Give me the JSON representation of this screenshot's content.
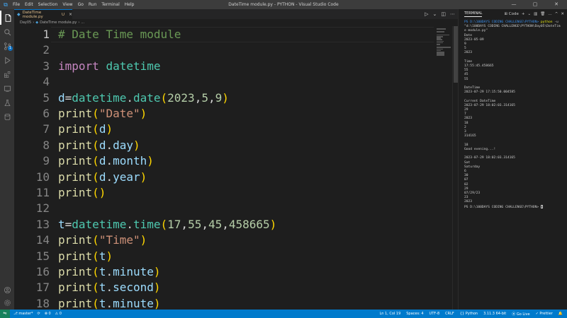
{
  "titlebar": {
    "menu": [
      "File",
      "Edit",
      "Selection",
      "View",
      "Go",
      "Run",
      "Terminal",
      "Help"
    ],
    "title": "DateTime module.py - PYTHON - Visual Studio Code",
    "min": "—",
    "max": "▢",
    "close": "✕"
  },
  "tab": {
    "label": "DateTime module.py",
    "modified": "U",
    "close": "×"
  },
  "breadcrumb": {
    "folder": "Day05",
    "sep": "›",
    "file": "DateTime module.py",
    "sep2": "›",
    "more": "..."
  },
  "editor": {
    "current_line": 1,
    "lines": [
      {
        "n": "1",
        "tokens": [
          [
            "comment",
            "# Date Time module"
          ]
        ]
      },
      {
        "n": "2",
        "tokens": []
      },
      {
        "n": "3",
        "tokens": [
          [
            "kw",
            "import"
          ],
          [
            "op",
            " "
          ],
          [
            "mod",
            "datetime"
          ]
        ]
      },
      {
        "n": "4",
        "tokens": []
      },
      {
        "n": "5",
        "tokens": [
          [
            "var",
            "d"
          ],
          [
            "op",
            "="
          ],
          [
            "mod",
            "datetime"
          ],
          [
            "op",
            "."
          ],
          [
            "mod",
            "date"
          ],
          [
            "br1",
            "("
          ],
          [
            "num",
            "2023"
          ],
          [
            "op",
            ","
          ],
          [
            "num",
            "5"
          ],
          [
            "op",
            ","
          ],
          [
            "num",
            "9"
          ],
          [
            "br1",
            ")"
          ]
        ]
      },
      {
        "n": "6",
        "tokens": [
          [
            "fn",
            "print"
          ],
          [
            "br1",
            "("
          ],
          [
            "str",
            "\"Date\""
          ],
          [
            "br1",
            ")"
          ]
        ]
      },
      {
        "n": "7",
        "tokens": [
          [
            "fn",
            "print"
          ],
          [
            "br1",
            "("
          ],
          [
            "var",
            "d"
          ],
          [
            "br1",
            ")"
          ]
        ]
      },
      {
        "n": "8",
        "tokens": [
          [
            "fn",
            "print"
          ],
          [
            "br1",
            "("
          ],
          [
            "var",
            "d"
          ],
          [
            "op",
            "."
          ],
          [
            "var",
            "day"
          ],
          [
            "br1",
            ")"
          ]
        ]
      },
      {
        "n": "9",
        "tokens": [
          [
            "fn",
            "print"
          ],
          [
            "br1",
            "("
          ],
          [
            "var",
            "d"
          ],
          [
            "op",
            "."
          ],
          [
            "var",
            "month"
          ],
          [
            "br1",
            ")"
          ]
        ]
      },
      {
        "n": "10",
        "tokens": [
          [
            "fn",
            "print"
          ],
          [
            "br1",
            "("
          ],
          [
            "var",
            "d"
          ],
          [
            "op",
            "."
          ],
          [
            "var",
            "year"
          ],
          [
            "br1",
            ")"
          ]
        ]
      },
      {
        "n": "11",
        "tokens": [
          [
            "fn",
            "print"
          ],
          [
            "br1",
            "()"
          ]
        ]
      },
      {
        "n": "12",
        "tokens": []
      },
      {
        "n": "13",
        "tokens": [
          [
            "var",
            "t"
          ],
          [
            "op",
            "="
          ],
          [
            "mod",
            "datetime"
          ],
          [
            "op",
            "."
          ],
          [
            "mod",
            "time"
          ],
          [
            "br1",
            "("
          ],
          [
            "num",
            "17"
          ],
          [
            "op",
            ","
          ],
          [
            "num",
            "55"
          ],
          [
            "op",
            ","
          ],
          [
            "num",
            "45"
          ],
          [
            "op",
            ","
          ],
          [
            "num",
            "458665"
          ],
          [
            "br1",
            ")"
          ]
        ]
      },
      {
        "n": "14",
        "tokens": [
          [
            "fn",
            "print"
          ],
          [
            "br1",
            "("
          ],
          [
            "str",
            "\"Time\""
          ],
          [
            "br1",
            ")"
          ]
        ]
      },
      {
        "n": "15",
        "tokens": [
          [
            "fn",
            "print"
          ],
          [
            "br1",
            "("
          ],
          [
            "var",
            "t"
          ],
          [
            "br1",
            ")"
          ]
        ]
      },
      {
        "n": "16",
        "tokens": [
          [
            "fn",
            "print"
          ],
          [
            "br1",
            "("
          ],
          [
            "var",
            "t"
          ],
          [
            "op",
            "."
          ],
          [
            "var",
            "minute"
          ],
          [
            "br1",
            ")"
          ]
        ]
      },
      {
        "n": "17",
        "tokens": [
          [
            "fn",
            "print"
          ],
          [
            "br1",
            "("
          ],
          [
            "var",
            "t"
          ],
          [
            "op",
            "."
          ],
          [
            "var",
            "second"
          ],
          [
            "br1",
            ")"
          ]
        ]
      },
      {
        "n": "18",
        "tokens": [
          [
            "fn",
            "print"
          ],
          [
            "br1",
            "("
          ],
          [
            "var",
            "t"
          ],
          [
            "op",
            "."
          ],
          [
            "var",
            "minute"
          ],
          [
            "br1",
            ")"
          ]
        ]
      }
    ]
  },
  "panel": {
    "title": "TERMINAL",
    "actions": [
      "⊞ Code",
      "+",
      "⌄",
      "▥",
      "🗑",
      "…",
      "^",
      "✕"
    ]
  },
  "terminal": {
    "prompt_path": "PS D:\\100DAYS CODING CHALLENGE\\PYTHON>",
    "cmd": "python",
    "cmd_args": " -u \"d:\\100DAYS CODING CHALLENGE\\PYTHON\\Day05\\DateTime module.py\"",
    "output": [
      "Date",
      "2023-05-09",
      "9",
      "5",
      "2023",
      "",
      "Time",
      "17:55:45.458665",
      "55",
      "45",
      "55",
      "",
      "DateTime",
      "2023-07-29 17:15:50.004585",
      "",
      "Current DateTime",
      "2023-07-29 18:02:03.314165",
      "29",
      "7",
      "2023",
      "18",
      "2",
      "3",
      "314165",
      "",
      "18",
      "Good evening...!",
      "",
      "2023-07-29 18:02:03.314165",
      "Sat",
      "Saturday",
      "6",
      "30",
      "07",
      "02",
      "29",
      "07/29/23",
      "23",
      "2023"
    ],
    "final_prompt": "PS D:\\100DAYS CODING CHALLENGE\\PYTHON>"
  },
  "statusbar": {
    "branch": "master*",
    "sync": "⟳",
    "errors": "⊗ 0",
    "warnings": "⚠ 0",
    "position": "Ln 1, Col 19",
    "spaces": "Spaces: 4",
    "encoding": "UTF-8",
    "eol": "CRLF",
    "lang_glyph": "{}",
    "language": "Python",
    "interpreter": "3.11.3 64-bit",
    "golive": "⦿ Go Live",
    "prettier": "✓ Prettier",
    "bell": "🔔"
  },
  "colors": {
    "accent": "#007acc",
    "remote": "#16825d",
    "comment": "#6a9955",
    "keyword": "#c586c0",
    "string": "#ce9178"
  }
}
